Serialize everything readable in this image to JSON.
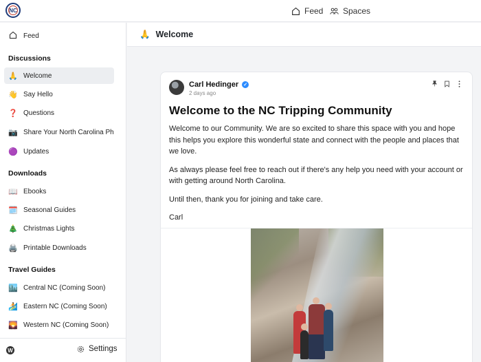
{
  "topbar": {
    "logo_text": "NC",
    "nav": [
      {
        "label": "Feed",
        "icon": "home-icon"
      },
      {
        "label": "Spaces",
        "icon": "people-icon"
      }
    ]
  },
  "sidebar": {
    "feed_label": "Feed",
    "sections": [
      {
        "heading": "Discussions",
        "items": [
          {
            "emoji": "🙏",
            "label": "Welcome",
            "active": true
          },
          {
            "emoji": "👋",
            "label": "Say Hello"
          },
          {
            "emoji": "❓",
            "label": "Questions"
          },
          {
            "emoji": "📷",
            "label": "Share Your North Carolina Ph..."
          },
          {
            "emoji": "🟣",
            "label": "Updates"
          }
        ]
      },
      {
        "heading": "Downloads",
        "items": [
          {
            "emoji": "📖",
            "label": "Ebooks"
          },
          {
            "emoji": "🗓️",
            "label": "Seasonal Guides"
          },
          {
            "emoji": "🎄",
            "label": "Christmas Lights"
          },
          {
            "emoji": "🖨️",
            "label": "Printable Downloads"
          }
        ]
      },
      {
        "heading": "Travel Guides",
        "items": [
          {
            "emoji": "🏙️",
            "label": "Central NC (Coming Soon)"
          },
          {
            "emoji": "🏄",
            "label": "Eastern NC (Coming Soon)"
          },
          {
            "emoji": "🌄",
            "label": "Western NC (Coming Soon)"
          }
        ]
      }
    ],
    "footer": {
      "wp_icon": "W",
      "settings_label": "Settings"
    }
  },
  "header": {
    "emoji": "🙏",
    "title": "Welcome"
  },
  "post": {
    "author": "Carl Hedinger",
    "verified_mark": "✓",
    "time": "2 days ago",
    "title": "Welcome to the NC Tripping Community",
    "paragraphs": [
      "Welcome to our Community. We are so excited to share this space with you and hope this helps you explore this wonderful state and connect with the people and places that we love.",
      "As always please feel free to reach out if there's any help you need with your account or with getting around North Carolina.",
      "Until then, thank you for joining and take care.",
      "Carl"
    ],
    "action_icons": [
      "pin-icon",
      "bookmark-icon",
      "more-icon"
    ]
  },
  "colors": {
    "accent": "#2d8cff",
    "active_bg": "#eceef1",
    "border": "#e5e7eb"
  }
}
